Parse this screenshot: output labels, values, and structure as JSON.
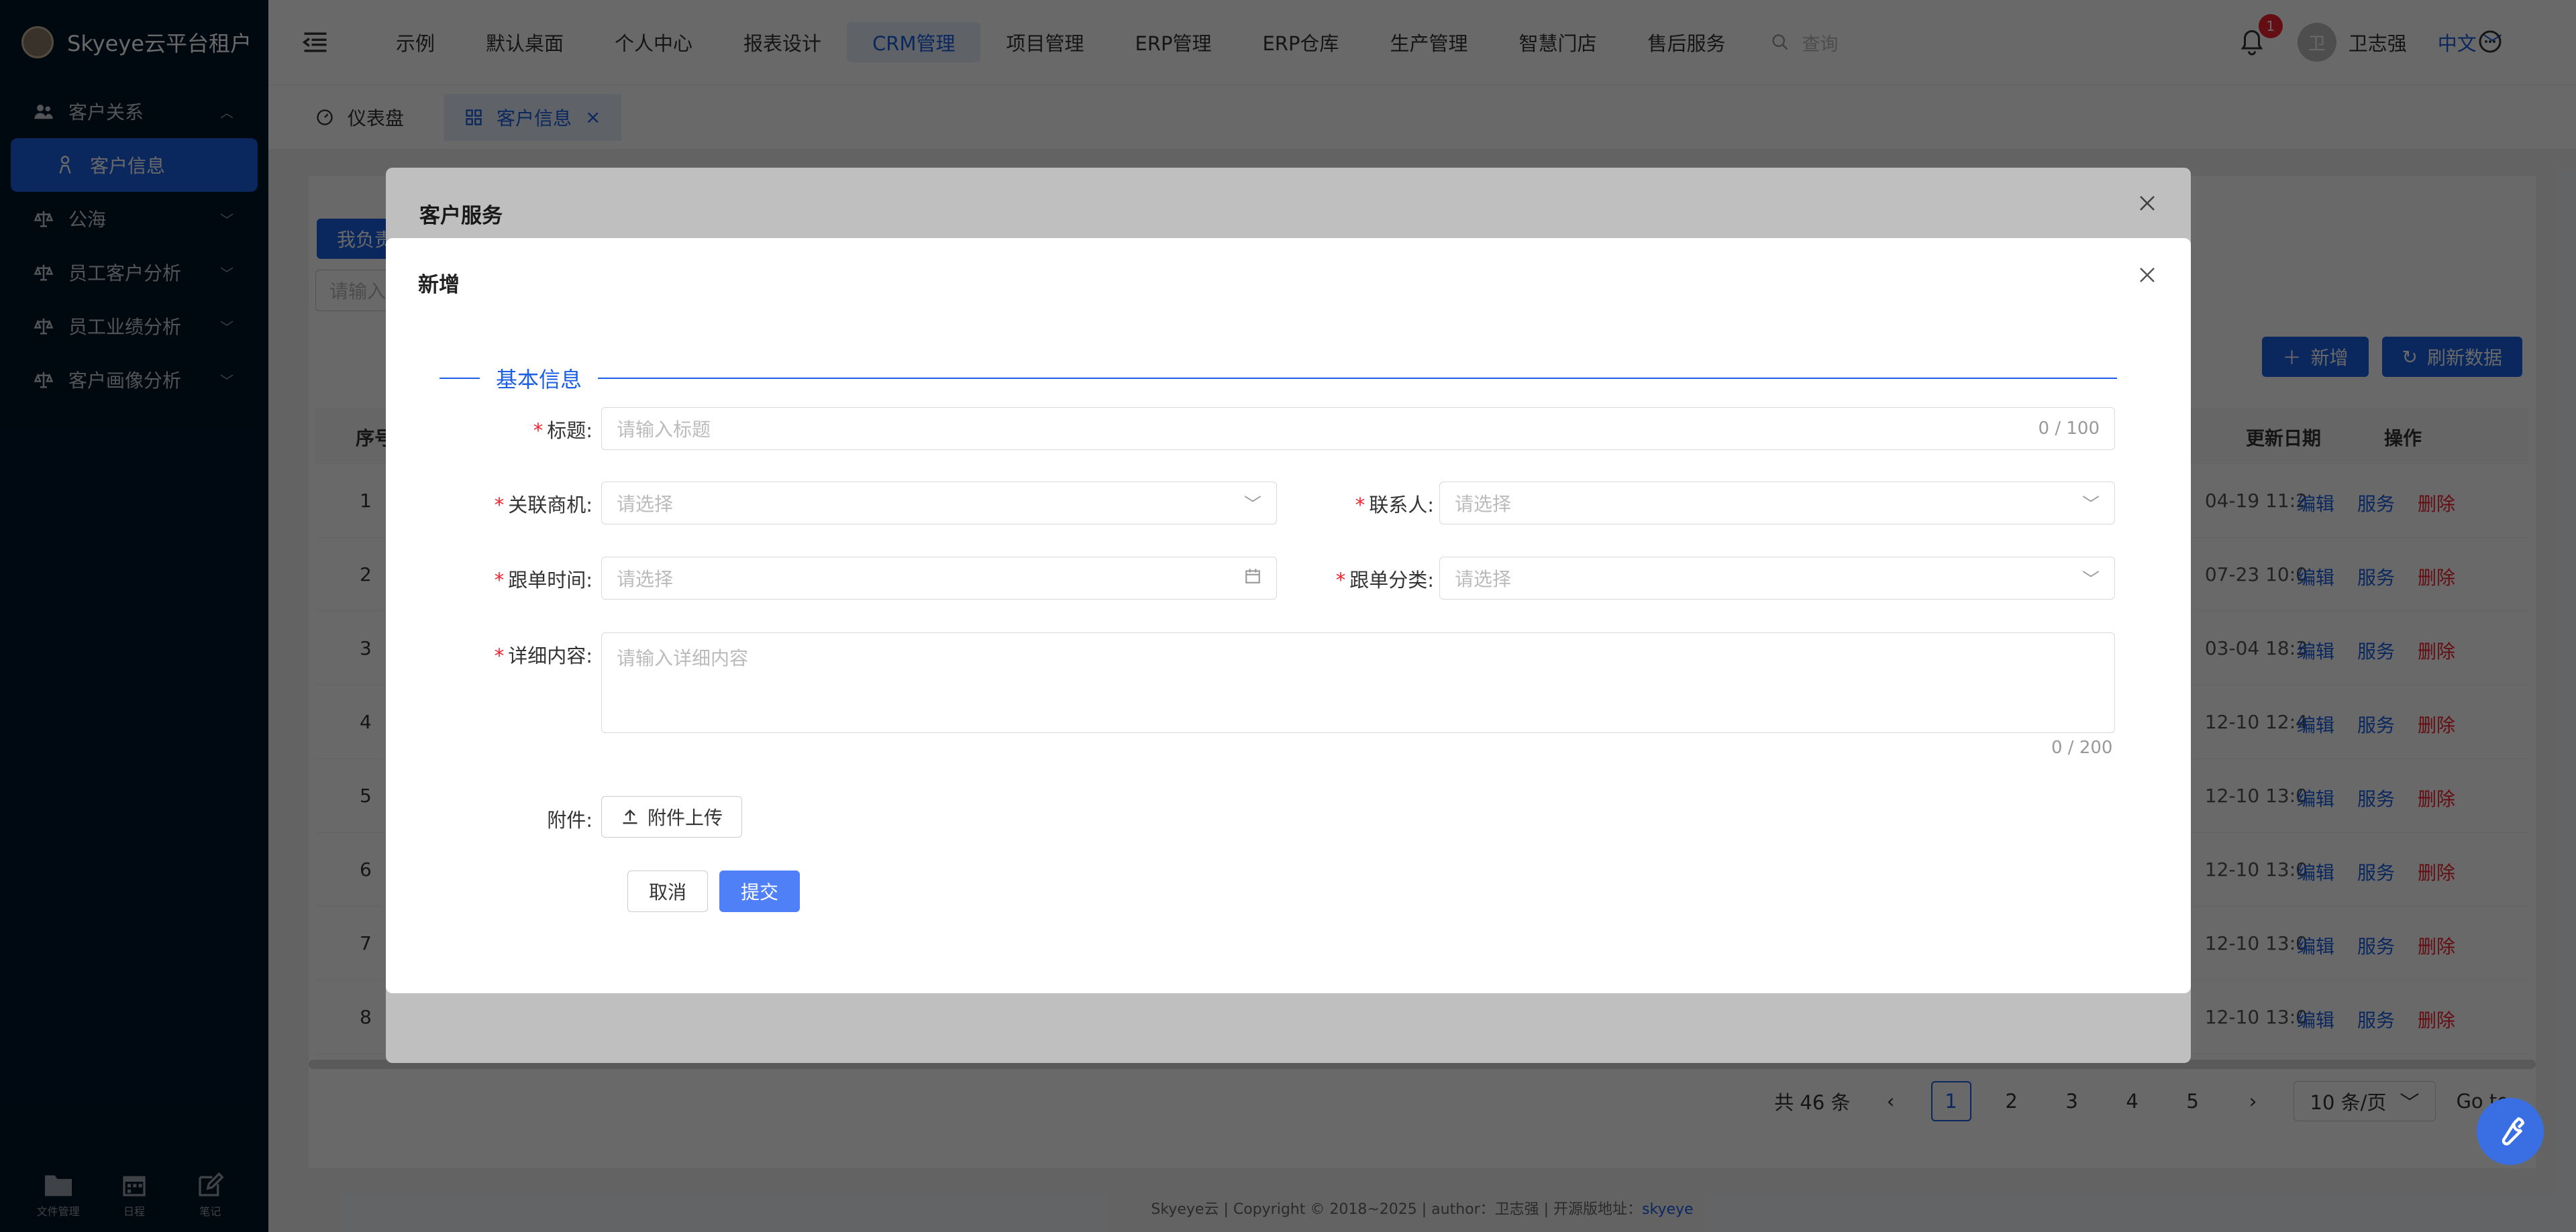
{
  "brand": {
    "name": "Skyeye云平台租户"
  },
  "sidebar": {
    "items": [
      {
        "label": "客户关系",
        "icon": "users-icon"
      },
      {
        "label": "客户信息",
        "icon": "person-icon"
      },
      {
        "label": "公海",
        "icon": "scale-icon"
      },
      {
        "label": "员工客户分析",
        "icon": "scale-icon"
      },
      {
        "label": "员工业绩分析",
        "icon": "scale-icon"
      },
      {
        "label": "客户画像分析",
        "icon": "scale-icon"
      }
    ],
    "bottom_tools": [
      {
        "label": "文件管理",
        "icon": "folder-icon"
      },
      {
        "label": "日程",
        "icon": "calendar-icon"
      },
      {
        "label": "笔记",
        "icon": "edit-icon"
      }
    ]
  },
  "topnav": {
    "items": [
      "示例",
      "默认桌面",
      "个人中心",
      "报表设计",
      "CRM管理",
      "项目管理",
      "ERP管理",
      "ERP仓库",
      "生产管理",
      "智慧门店",
      "售后服务"
    ],
    "search_placeholder": "查询",
    "notification_count": "1",
    "user_name": "卫志强",
    "user_initial": "卫",
    "language": "中文"
  },
  "tabs": [
    {
      "label": "仪表盘"
    },
    {
      "label": "客户信息"
    }
  ],
  "page": {
    "my_tab": "我负责",
    "search_placeholder": "请输入",
    "add_button": "新增",
    "refresh_button": "刷新数据",
    "col_index": "序号",
    "col_date": "更新日期",
    "col_actions": "操作",
    "rows": [
      {
        "idx": "1",
        "date": "04-19 11:2",
        "edit": "编辑",
        "service": "服务",
        "delete": "删除"
      },
      {
        "idx": "2",
        "date": "07-23 10:0",
        "edit": "编辑",
        "service": "服务",
        "delete": "删除"
      },
      {
        "idx": "3",
        "date": "03-04 18:3",
        "edit": "编辑",
        "service": "服务",
        "delete": "删除"
      },
      {
        "idx": "4",
        "date": "12-10 12:4",
        "edit": "编辑",
        "service": "服务",
        "delete": "删除"
      },
      {
        "idx": "5",
        "date": "12-10 13:0",
        "edit": "编辑",
        "service": "服务",
        "delete": "删除"
      },
      {
        "idx": "6",
        "date": "12-10 13:0",
        "edit": "编辑",
        "service": "服务",
        "delete": "删除"
      },
      {
        "idx": "7",
        "date": "12-10 13:0",
        "edit": "编辑",
        "service": "服务",
        "delete": "删除"
      },
      {
        "idx": "8",
        "date": "12-10 13:0",
        "edit": "编辑",
        "service": "服务",
        "delete": "删除"
      }
    ],
    "pagination": {
      "total": "共 46 条",
      "pages": [
        "1",
        "2",
        "3",
        "4",
        "5"
      ],
      "current": "1",
      "page_size": "10 条/页",
      "goto": "Go to"
    },
    "footer_text": "Skyeye云 | Copyright © 2018~2025 | author：卫志强 | 开源版地址：",
    "footer_link": "skyeye"
  },
  "modal_back": {
    "title": "客户服务"
  },
  "modal": {
    "title": "新增",
    "section": "基本信息",
    "fields": {
      "title_label": "标题",
      "title_placeholder": "请输入标题",
      "title_counter": "0 / 100",
      "opportunity_label": "关联商机",
      "opportunity_placeholder": "请选择",
      "contact_label": "联系人",
      "contact_placeholder": "请选择",
      "followup_time_label": "跟单时间",
      "followup_time_placeholder": "请选择",
      "followup_type_label": "跟单分类",
      "followup_type_placeholder": "请选择",
      "detail_label": "详细内容",
      "detail_placeholder": "请输入详细内容",
      "detail_counter": "0 / 200",
      "attachment_label": "附件",
      "upload_button": "附件上传"
    },
    "cancel": "取消",
    "submit": "提交"
  },
  "colors": {
    "primary": "#1b5fe6",
    "sidebar_bg": "#001529",
    "danger": "#f5222d",
    "submit": "#4f80f7"
  }
}
